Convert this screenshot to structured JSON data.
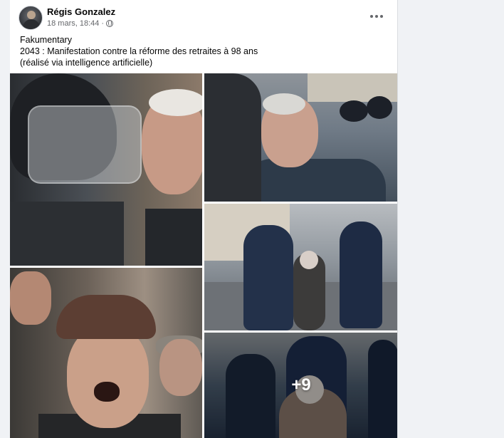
{
  "post": {
    "author": "Régis Gonzalez",
    "timestamp": "18 mars, 18:44 · ",
    "audience_icon": "globe-icon",
    "more_icon": "more-options-icon",
    "caption_lines": [
      "Fakumentary",
      "2043 : Manifestation contre la réforme des retraites à 98 ans",
      "(réalisé via intelligence artificielle)"
    ]
  },
  "gallery": {
    "tiles": [
      "photo-1",
      "photo-2",
      "photo-3",
      "photo-4",
      "photo-5"
    ],
    "more_count": "+9"
  },
  "colors": {
    "page_background": "#f0f2f5",
    "card_background": "#ffffff",
    "text_primary": "#050505",
    "text_secondary": "#65676b"
  }
}
